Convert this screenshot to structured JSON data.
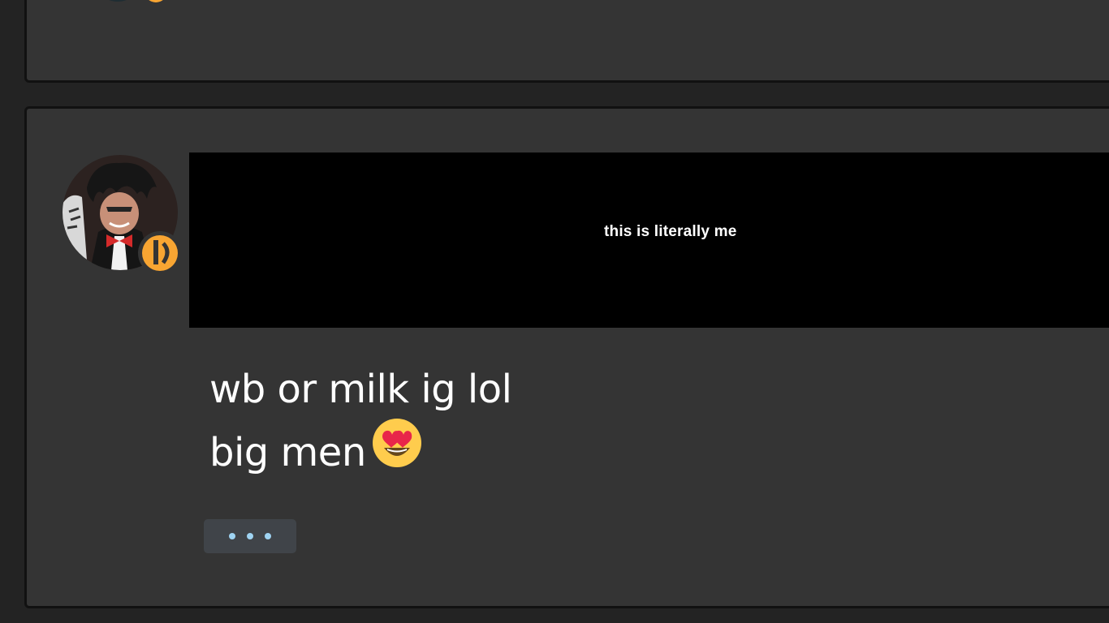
{
  "post": {
    "media_caption": "this is literally me",
    "message_lines": [
      "wb or milk ig lol",
      "big men"
    ],
    "emoji": "heart-eyes-emoji"
  },
  "more_button": {
    "icon": "ellipsis-icon"
  },
  "colors": {
    "page_background": "#232323",
    "card_background": "#343434",
    "card_border": "#111111",
    "media_background": "#000000",
    "status_badge": "#f8a532",
    "more_button_background": "#404449",
    "more_button_dots": "#9fd4f3"
  }
}
